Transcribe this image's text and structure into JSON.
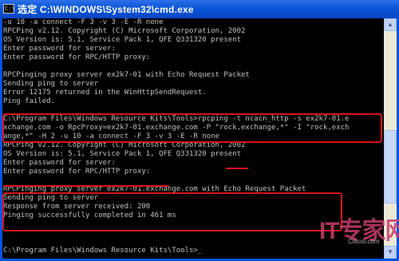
{
  "window": {
    "title": "选定 C:\\WINDOWS\\System32\\cmd.exe",
    "icon": "cmd-icon",
    "icon_glyph": "C:\\"
  },
  "console": {
    "lines": [
      "-u 10 -a connect -F 3 -v 3 -E -R none",
      "RPCPing v2.12. Copyright (C) Microsoft Corporation, 2002",
      "OS Version is: 5.1, Service Pack 1, QFE Q331320 present",
      "Enter password for server:",
      "Enter password for RPC/HTTP proxy:",
      "",
      "RPCPinging proxy server ex2k7-01 with Echo Request Packet",
      "Sending ping to server",
      "Error 12175 returned in the WinHttpSendRequest.",
      "Ping failed.",
      "",
      "C:\\Program Files\\Windows Resource Kits\\Tools>rpcping -t ncacn_http -s ex2k7-01.e",
      "xchange.com -o RpcProxy=ex2k7-01.exchange.com -P \"rock,exchange,*\" -I \"rock,exch",
      "ange,*\" -H 2 -u 10 -a connect -F 3 -v 3 -E -R none",
      "RPCPing v2.12. Copyright (C) Microsoft Corporation, 2002",
      "OS Version is: 5.1, Service Pack 1, QFE Q331320 present",
      "Enter password for server:",
      "Enter password for RPC/HTTP proxy:",
      "",
      "RPCPinging proxy server ex2k7-01.exchange.com with Echo Request Packet",
      "Sending ping to server",
      "Response from server received: 200",
      "Pinging successfully completed in 461 ms",
      "",
      "C:\\Program Files\\Windows Resource Kits\\Tools>_"
    ]
  },
  "watermark": {
    "brand": "IT专家网",
    "site": "Ciocio.com"
  },
  "colors": {
    "console_bg": "#000000",
    "console_text": "#c0c0c0",
    "highlight": "#d8141c",
    "titlebar": "#0a56d8"
  }
}
